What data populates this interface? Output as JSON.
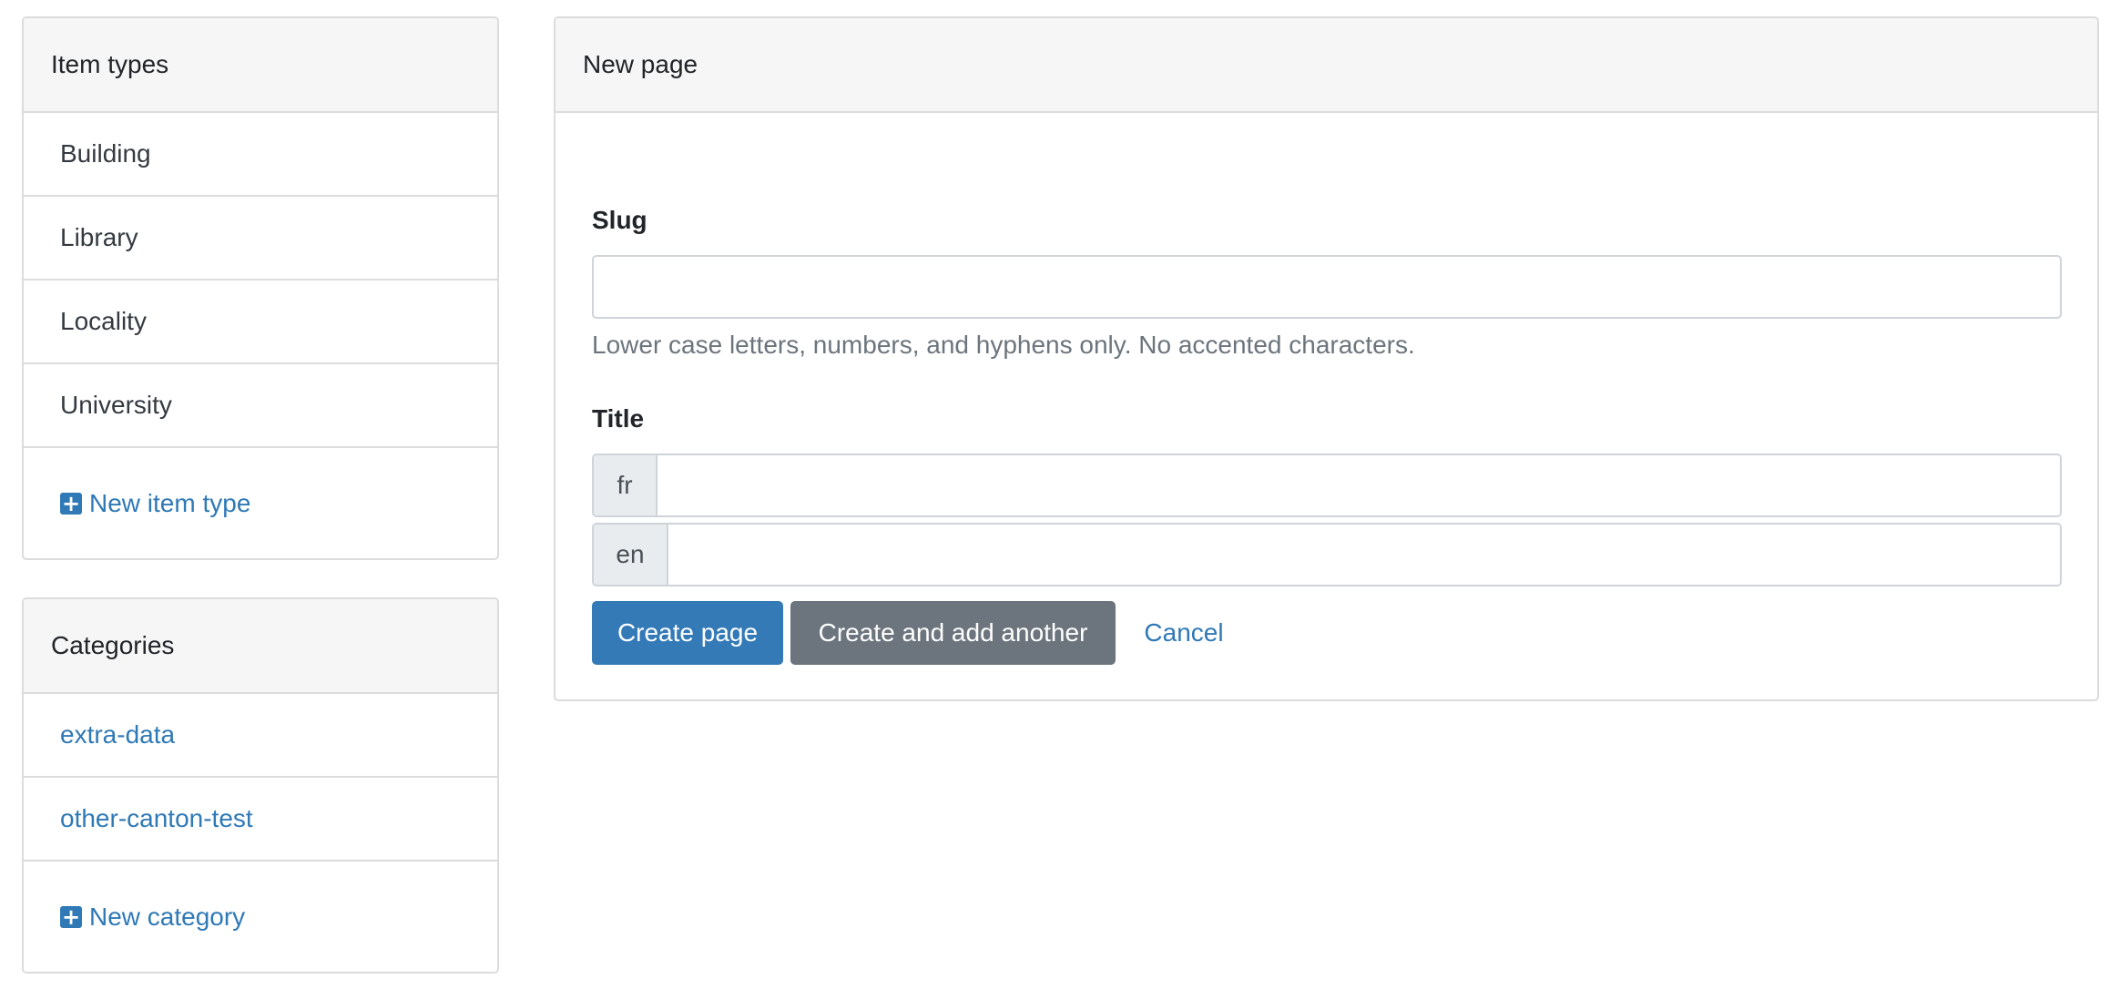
{
  "item_types": {
    "title": "Item types",
    "items": [
      {
        "label": "Building"
      },
      {
        "label": "Library"
      },
      {
        "label": "Locality"
      },
      {
        "label": "University"
      }
    ],
    "add_label": "New item type"
  },
  "categories": {
    "title": "Categories",
    "items": [
      {
        "label": "extra-data"
      },
      {
        "label": "other-canton-test"
      }
    ],
    "add_label": "New category"
  },
  "form": {
    "title": "New page",
    "slug": {
      "label": "Slug",
      "value": "",
      "help": "Lower case letters, numbers, and hyphens only. No accented characters."
    },
    "title_field": {
      "label": "Title",
      "languages": [
        {
          "code": "fr",
          "value": ""
        },
        {
          "code": "en",
          "value": ""
        }
      ]
    },
    "buttons": {
      "create": "Create page",
      "create_another": "Create and add another",
      "cancel": "Cancel"
    }
  },
  "colors": {
    "link": "#2f79b6",
    "primary": "#337ab7",
    "secondary": "#6c757d",
    "header_bg": "#f6f6f6",
    "border": "#dcdcdc"
  },
  "icons": {
    "add": "plus-square-icon"
  }
}
